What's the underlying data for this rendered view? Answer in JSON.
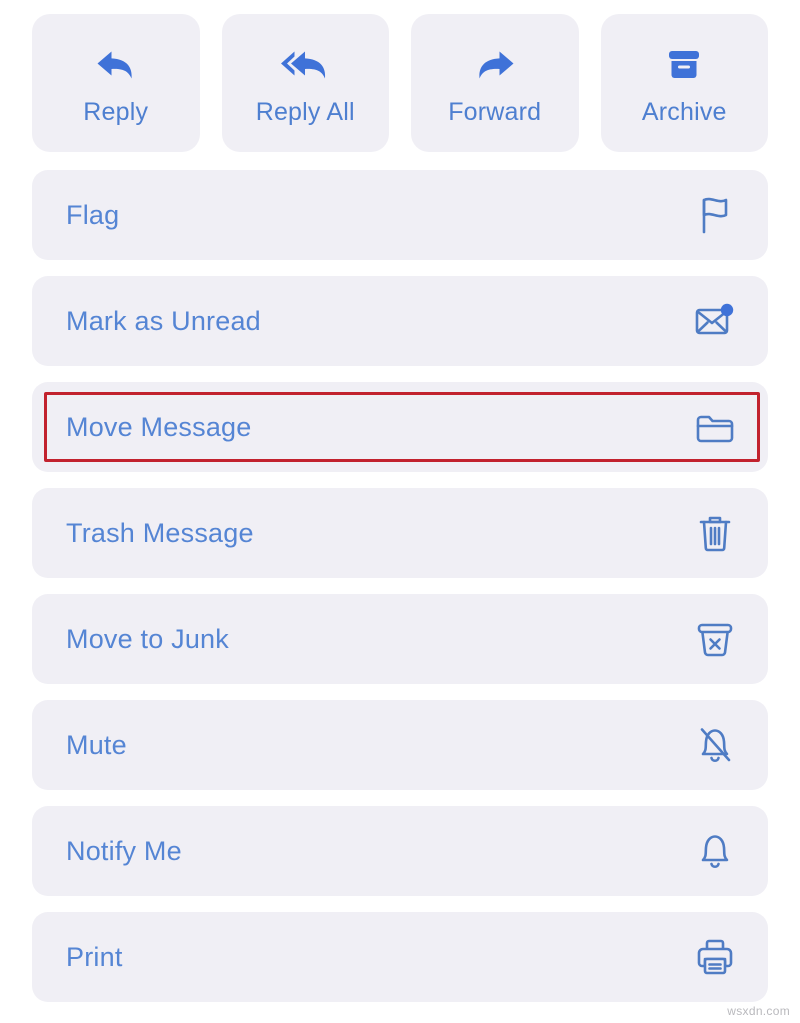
{
  "theme": {
    "page_background": "#ffffff",
    "card_background": "#f0eff5",
    "quick_icon_color": "#3f72d8",
    "quick_label_color": "#4e7fd0",
    "row_label_color": "#5585d4",
    "row_icon_color": "#4f7cc4",
    "highlight_border_color": "#c2222e"
  },
  "quick_actions": [
    {
      "label": "Reply",
      "icon": "reply-arrow-icon"
    },
    {
      "label": "Reply All",
      "icon": "reply-all-arrow-icon"
    },
    {
      "label": "Forward",
      "icon": "forward-arrow-icon"
    },
    {
      "label": "Archive",
      "icon": "archive-box-icon"
    }
  ],
  "menu_rows": [
    {
      "label": "Flag",
      "icon": "flag-icon",
      "highlighted": false
    },
    {
      "label": "Mark as Unread",
      "icon": "envelope-badge-icon",
      "highlighted": false
    },
    {
      "label": "Move Message",
      "icon": "folder-icon",
      "highlighted": true
    },
    {
      "label": "Trash Message",
      "icon": "trash-icon",
      "highlighted": false
    },
    {
      "label": "Move to Junk",
      "icon": "junk-bin-x-icon",
      "highlighted": false
    },
    {
      "label": "Mute",
      "icon": "bell-slash-icon",
      "highlighted": false
    },
    {
      "label": "Notify Me",
      "icon": "bell-icon",
      "highlighted": false
    },
    {
      "label": "Print",
      "icon": "printer-icon",
      "highlighted": false
    }
  ],
  "watermark": {
    "text": "wsxdn.com"
  }
}
